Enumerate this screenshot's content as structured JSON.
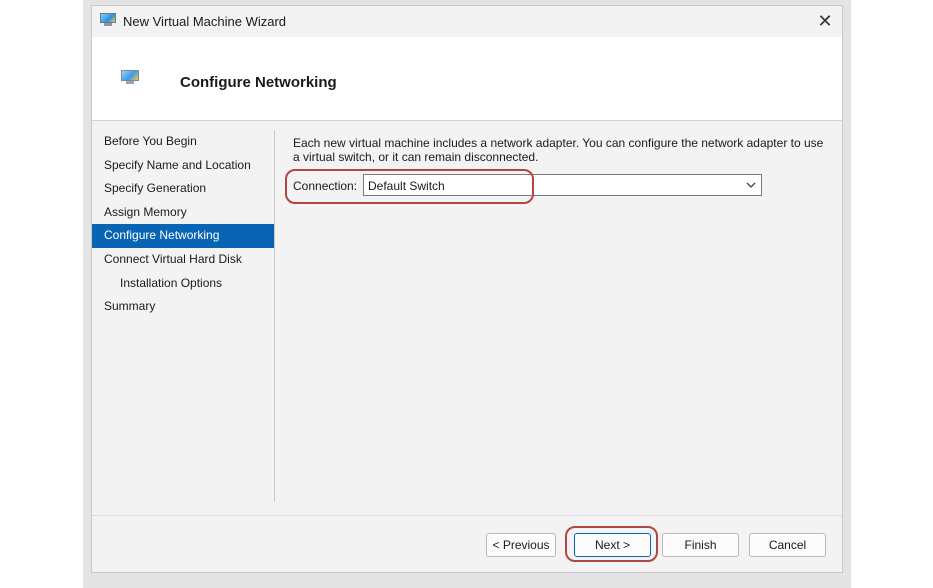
{
  "window": {
    "title": "New Virtual Machine Wizard",
    "close_glyph": "✕"
  },
  "header": {
    "title": "Configure Networking"
  },
  "nav": {
    "items": [
      {
        "label": "Before You Begin"
      },
      {
        "label": "Specify Name and Location"
      },
      {
        "label": "Specify Generation"
      },
      {
        "label": "Assign Memory"
      },
      {
        "label": "Configure Networking"
      },
      {
        "label": "Connect Virtual Hard Disk"
      },
      {
        "label": "Installation Options"
      },
      {
        "label": "Summary"
      }
    ],
    "active": "Configure Networking"
  },
  "content": {
    "description": "Each new virtual machine includes a network adapter. You can configure the network adapter to use a virtual switch, or it can remain disconnected.",
    "connection_label": "Connection:",
    "connection_value": "Default Switch"
  },
  "buttons": {
    "previous": "< Previous",
    "next": "Next >",
    "finish": "Finish",
    "cancel": "Cancel"
  },
  "colors": {
    "accent": "#0a64b4",
    "highlight": "#b34545"
  }
}
